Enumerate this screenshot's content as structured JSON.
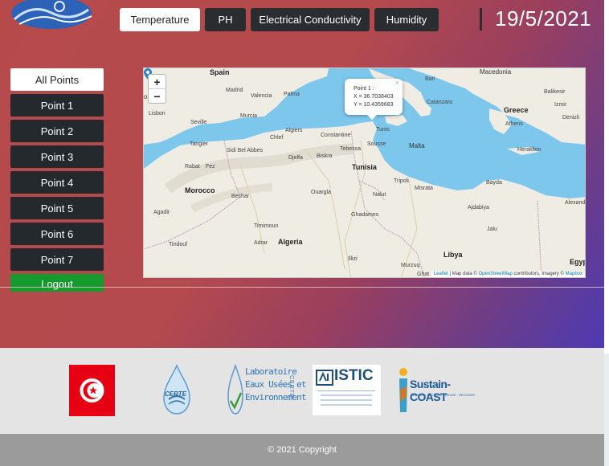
{
  "header": {
    "tabs": [
      {
        "label": "Temperature",
        "active": true
      },
      {
        "label": "PH",
        "active": false
      },
      {
        "label": "Electrical Conductivity",
        "active": false
      },
      {
        "label": "Humidity",
        "active": false
      }
    ],
    "date": "19/5/2021"
  },
  "sidebar": {
    "items": [
      {
        "label": "All Points",
        "active": true
      },
      {
        "label": "Point 1"
      },
      {
        "label": "Point 2"
      },
      {
        "label": "Point 3"
      },
      {
        "label": "Point 4"
      },
      {
        "label": "Point 5"
      },
      {
        "label": "Point 6"
      },
      {
        "label": "Point 7"
      }
    ],
    "logout": "Logout"
  },
  "map": {
    "zoom_in": "+",
    "zoom_out": "−",
    "popup": {
      "title": "Point 1 :",
      "x": "X = 36.7038403",
      "y": "Y = 10.4359683",
      "close": "×"
    },
    "attribution": {
      "leaflet": "Leaflet",
      "prefix": " | Map data © ",
      "osm": "OpenStreetMap",
      "middle": " contributors, Imagery © ",
      "mapbox": "Mapbox"
    },
    "labels": {
      "spain": "Spain",
      "madrid": "Madrid",
      "portugal": "ortugal",
      "lisbon": "Lisbon",
      "valencia": "Valencia",
      "palma": "Palma",
      "seville": "Seville",
      "murcia": "Murcia",
      "tangier": "Tangier",
      "rabat": "Rabat",
      "fez": "Fez",
      "morocco": "Morocco",
      "agadir": "Agadir",
      "tindouf": "Tindouf",
      "bechar": "Bechar",
      "sidibelabbes": "Sidi Bel Abbes",
      "chlef": "Chlef",
      "algiers": "Algiers",
      "constantine": "Constantine",
      "djelfa": "Djelfa",
      "biskra": "Biskra",
      "tebessa": "Tebessa",
      "tunis": "Tunis",
      "sousse": "Sousse",
      "tunisia": "Tunisia",
      "ouargla": "Ouargla",
      "ghadames": "Ghadames",
      "timimoun": "Timimoun",
      "adrar": "Adrar",
      "algeria": "Algeria",
      "illizi": "Illizi",
      "murzuq": "Murzuq",
      "libya": "Libya",
      "jalu": "Jalu",
      "tripoli": "Tripoli",
      "misrata": "Misrata",
      "nalut": "Nalut",
      "bayda": "Bayda",
      "ajdabiya": "Ajdabiya",
      "alexandria": "Alexand",
      "egypt": "Egyp",
      "malta": "Malta",
      "catanzaro": "Catanzaro",
      "greece": "Greece",
      "athens": "Athens",
      "heraklion": "Heraklion",
      "balikesir": "Balikesir",
      "denizli": "Denizli",
      "izmir": "Izmir",
      "macedonia": "Macedonia",
      "bari": "Bari",
      "ghat": "Ghat"
    }
  },
  "footer": {
    "partners": [
      {
        "name": "tunisia-flag"
      },
      {
        "name": "certe-logo",
        "text": "CERTE"
      },
      {
        "name": "laboratoire-logo",
        "lines": [
          "Laboratoire",
          "Eaux Usées et",
          "Environnement"
        ],
        "side": "CERTE"
      },
      {
        "name": "istic-logo",
        "text": "ISTIC"
      },
      {
        "name": "sustain-coast-logo",
        "text": "Sustain-COAST",
        "sub": "REDUCE · RECYCLE · REUSE · RECOVER"
      }
    ],
    "copyright": "© 2021 Copyright"
  },
  "colors": {
    "dark_button": "#24292d",
    "logout": "#159a2e",
    "sea": "#7dc6ec",
    "land": "#efece3",
    "marker": "#2f84c9"
  }
}
